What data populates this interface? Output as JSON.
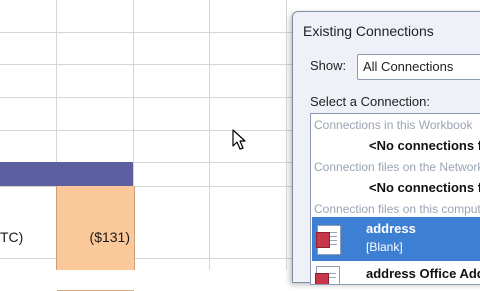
{
  "sheet": {
    "row_label": "TC)",
    "amount": "($131)"
  },
  "dialog": {
    "title": "Existing Connections",
    "show_label": "Show:",
    "show_value": "All Connections",
    "select_label": "Select a Connection:",
    "groups": [
      {
        "header": "Connections in this Workbook",
        "empty_text": "<No connections found>"
      },
      {
        "header": "Connection files on the Network",
        "empty_text": "<No connections found>"
      },
      {
        "header": "Connection files on this computer"
      }
    ],
    "items": [
      {
        "name": "address",
        "description": "[Blank]",
        "icon": "connection-file-icon",
        "selected": true
      },
      {
        "name": "address Office Address List",
        "icon": "connection-file-icon",
        "selected": false
      }
    ]
  },
  "colors": {
    "header_band": "#5b5fa0",
    "highlight_cell": "#fbc999",
    "selection": "#3d7fd3"
  }
}
